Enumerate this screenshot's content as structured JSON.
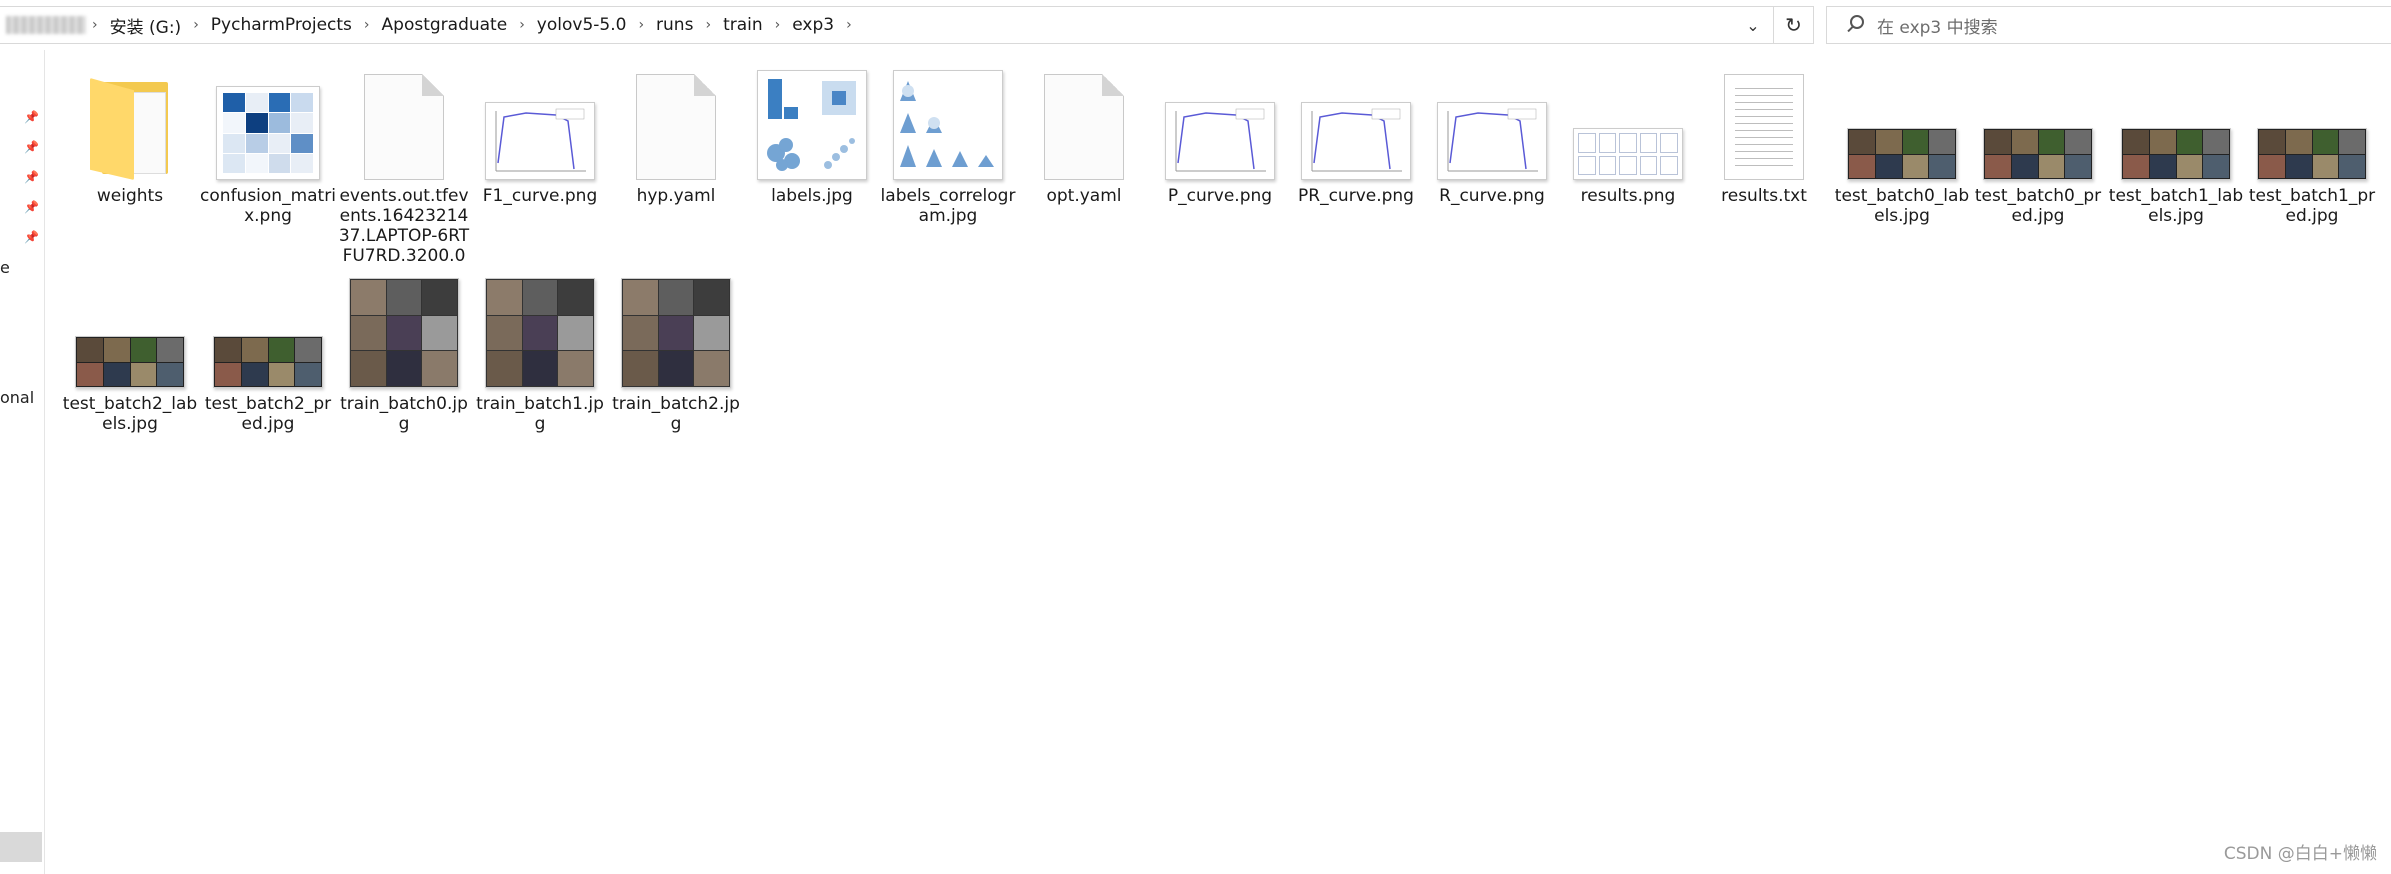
{
  "breadcrumb": {
    "items": [
      "安装 (G:)",
      "PycharmProjects",
      "Apostgraduate",
      "yolov5-5.0",
      "runs",
      "train",
      "exp3"
    ]
  },
  "search": {
    "placeholder": "在 exp3 中搜索"
  },
  "nav": {
    "fragment_1": "e",
    "fragment_2": "onal"
  },
  "files": [
    {
      "name": "weights",
      "kind": "folder"
    },
    {
      "name": "confusion_matrix.png",
      "kind": "confusion"
    },
    {
      "name": "events.out.tfevents.1642321437.LAPTOP-6RTFU7RD.3200.0",
      "kind": "blank"
    },
    {
      "name": "F1_curve.png",
      "kind": "curve"
    },
    {
      "name": "hyp.yaml",
      "kind": "blank"
    },
    {
      "name": "labels.jpg",
      "kind": "labels"
    },
    {
      "name": "labels_correlogram.jpg",
      "kind": "correlogram"
    },
    {
      "name": "opt.yaml",
      "kind": "blank"
    },
    {
      "name": "P_curve.png",
      "kind": "curve"
    },
    {
      "name": "PR_curve.png",
      "kind": "curve"
    },
    {
      "name": "R_curve.png",
      "kind": "curve"
    },
    {
      "name": "results.png",
      "kind": "results"
    },
    {
      "name": "results.txt",
      "kind": "text"
    },
    {
      "name": "test_batch0_labels.jpg",
      "kind": "photo"
    },
    {
      "name": "test_batch0_pred.jpg",
      "kind": "photo"
    },
    {
      "name": "test_batch1_labels.jpg",
      "kind": "photo"
    },
    {
      "name": "test_batch1_pred.jpg",
      "kind": "photo"
    },
    {
      "name": "test_batch2_labels.jpg",
      "kind": "photo"
    },
    {
      "name": "test_batch2_pred.jpg",
      "kind": "photo"
    },
    {
      "name": "train_batch0.jpg",
      "kind": "phototall"
    },
    {
      "name": "train_batch1.jpg",
      "kind": "phototall"
    },
    {
      "name": "train_batch2.jpg",
      "kind": "phototall"
    }
  ],
  "watermark": "CSDN @白白+懒懒"
}
